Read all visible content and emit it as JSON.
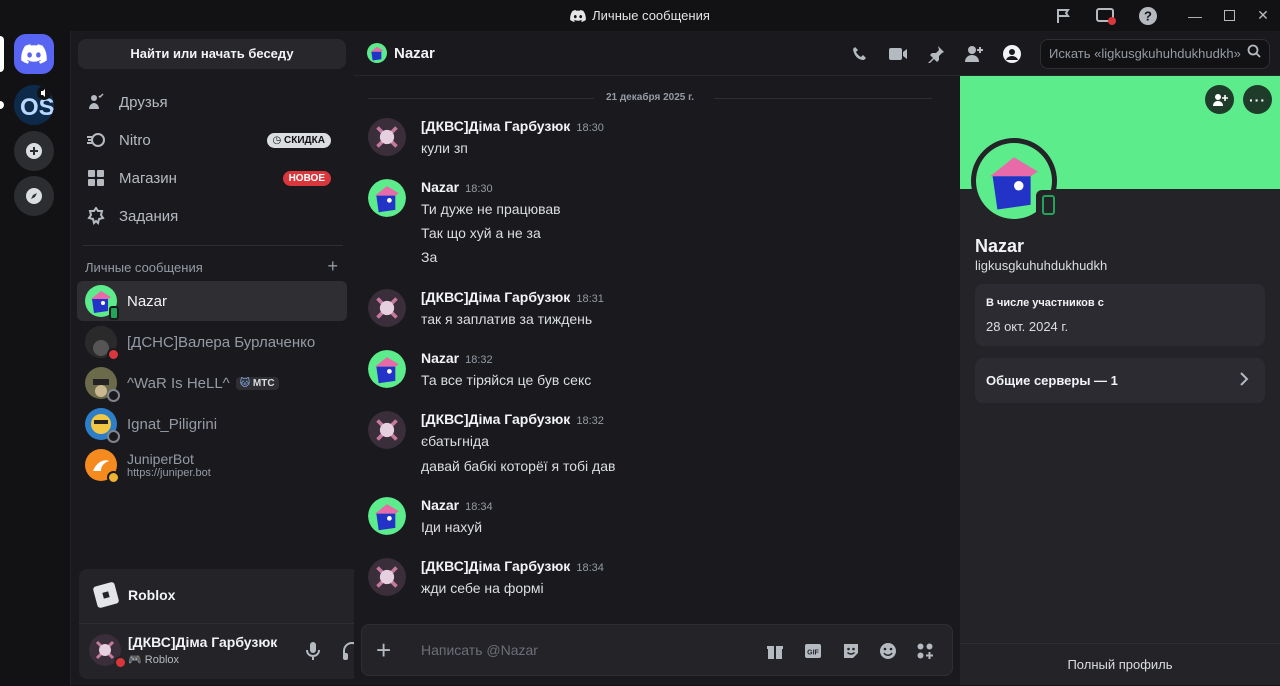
{
  "window": {
    "title": "Личные сообщения"
  },
  "channels": {
    "search_button": "Найти или начать беседу",
    "nav": [
      {
        "label": "Друзья"
      },
      {
        "label": "Nitro",
        "badge": "СКИДКА"
      },
      {
        "label": "Магазин",
        "badge": "НОВОЕ"
      },
      {
        "label": "Задания"
      }
    ],
    "dm_header": "Личные сообщения",
    "dms": [
      {
        "name": "Nazar"
      },
      {
        "name": "[ДСНС]Валера Бурлаченко"
      },
      {
        "name": "^WaR Is HeLL^",
        "tag": "МТС"
      },
      {
        "name": "Ignat_Piligrini"
      },
      {
        "name": "JuniperBot",
        "sub": "https://juniper.bot"
      }
    ]
  },
  "game_panel": {
    "name": "Roblox"
  },
  "user_panel": {
    "name": "[ДКВС]Діма Гарбузюк",
    "activity": "Roblox"
  },
  "chat": {
    "header_name": "Nazar",
    "search_placeholder": "Искать «ligkusgkuhuhdukhudkh»",
    "date": "21 декабря 2025 г.",
    "messages": [
      {
        "author": "[ДКВС]Діма Гарбузюк",
        "time": "18:30",
        "lines": [
          "кули зп"
        ]
      },
      {
        "author": "Nazar",
        "time": "18:30",
        "lines": [
          "Ти дуже не працював",
          "Так що хуй а не за",
          "За"
        ]
      },
      {
        "author": "[ДКВС]Діма Гарбузюк",
        "time": "18:31",
        "lines": [
          "так я заплатив за тиждень"
        ]
      },
      {
        "author": "Nazar",
        "time": "18:32",
        "lines": [
          "Та все тіряйся це був секс"
        ]
      },
      {
        "author": "[ДКВС]Діма Гарбузюк",
        "time": "18:32",
        "lines": [
          "єбатьгніда",
          "давай  бабкі которёї я тобі дав"
        ]
      },
      {
        "author": "Nazar",
        "time": "18:34",
        "lines": [
          "Іди нахуй"
        ]
      },
      {
        "author": "[ДКВС]Діма Гарбузюк",
        "time": "18:34",
        "lines": [
          "жди себе на формі"
        ]
      }
    ],
    "composer_placeholder": "Написать @Nazar"
  },
  "profile": {
    "name": "Nazar",
    "username": "ligkusgkuhuhdukhudkh",
    "member_since_label": "В числе участников с",
    "member_since": "28 окт. 2024 г.",
    "mutual_servers": "Общие серверы — 1",
    "full_profile": "Полный профиль"
  },
  "colors": {
    "accent": "#5865f2",
    "banner": "#5cec8b",
    "badge_new": "#da373c"
  }
}
